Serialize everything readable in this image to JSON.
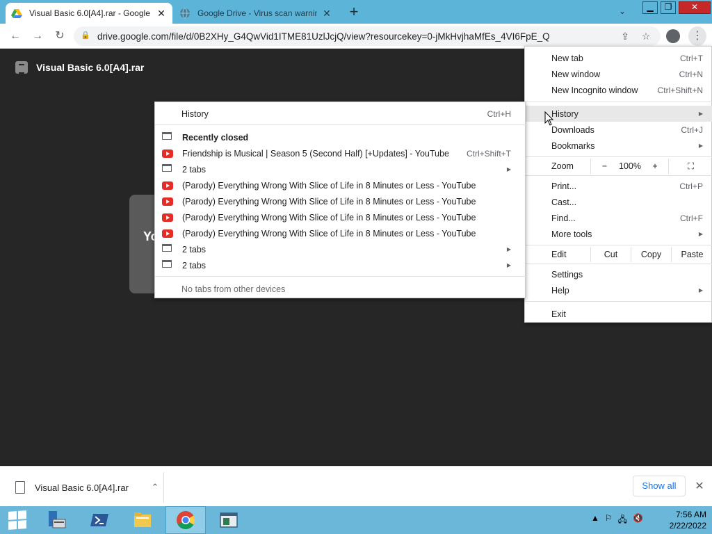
{
  "browser": {
    "tabs": [
      {
        "title": "Visual Basic 6.0[A4].rar - Google",
        "icon": "google-drive-icon",
        "active": true
      },
      {
        "title": "Google Drive - Virus scan warnin",
        "icon": "globe-icon",
        "active": false
      }
    ],
    "url": "drive.google.com/file/d/0B2XHy_G4QwVid1ITME81UzlJcjQ/view?resourcekey=0-jMkHvjhaMfEs_4VI6FpE_Q"
  },
  "page": {
    "file_title": "Visual Basic 6.0[A4].rar",
    "dialog_text_partial": "Yo"
  },
  "menu": {
    "new_tab": {
      "label": "New tab",
      "shortcut": "Ctrl+T"
    },
    "new_window": {
      "label": "New window",
      "shortcut": "Ctrl+N"
    },
    "incognito": {
      "label": "New Incognito window",
      "shortcut": "Ctrl+Shift+N"
    },
    "history": {
      "label": "History"
    },
    "downloads": {
      "label": "Downloads",
      "shortcut": "Ctrl+J"
    },
    "bookmarks": {
      "label": "Bookmarks"
    },
    "zoom": {
      "label": "Zoom",
      "minus": "−",
      "value": "100%",
      "plus": "+"
    },
    "print": {
      "label": "Print...",
      "shortcut": "Ctrl+P"
    },
    "cast": {
      "label": "Cast..."
    },
    "find": {
      "label": "Find...",
      "shortcut": "Ctrl+F"
    },
    "more_tools": {
      "label": "More tools"
    },
    "edit": {
      "label": "Edit",
      "cut": "Cut",
      "copy": "Copy",
      "paste": "Paste"
    },
    "settings": {
      "label": "Settings"
    },
    "help": {
      "label": "Help"
    },
    "exit": {
      "label": "Exit"
    }
  },
  "history_menu": {
    "history": {
      "label": "History",
      "shortcut": "Ctrl+H"
    },
    "recently_closed": "Recently closed",
    "items": [
      {
        "label": "Friendship is Musical | Season 5 (Second Half) [+Updates] - YouTube",
        "shortcut": "Ctrl+Shift+T",
        "type": "youtube"
      },
      {
        "label": "2 tabs",
        "type": "tabs"
      },
      {
        "label": "(Parody) Everything Wrong With Slice of Life in 8 Minutes or Less - YouTube",
        "type": "youtube"
      },
      {
        "label": "(Parody) Everything Wrong With Slice of Life in 8 Minutes or Less - YouTube",
        "type": "youtube"
      },
      {
        "label": "(Parody) Everything Wrong With Slice of Life in 8 Minutes or Less - YouTube",
        "type": "youtube"
      },
      {
        "label": "(Parody) Everything Wrong With Slice of Life in 8 Minutes or Less - YouTube",
        "type": "youtube"
      },
      {
        "label": "2 tabs",
        "type": "tabs"
      },
      {
        "label": "2 tabs",
        "type": "tabs"
      }
    ],
    "no_other_devices": "No tabs from other devices"
  },
  "download_shelf": {
    "file_name": "Visual Basic 6.0[A4].rar",
    "show_all": "Show all"
  },
  "taskbar": {
    "time": "7:56 AM",
    "date": "2/22/2022"
  },
  "colors": {
    "tabstrip": "#5cb4d9",
    "taskbar": "#6ab7d9",
    "content_bg": "#262626",
    "youtube_red": "#e52d27",
    "link_blue": "#1a73e8"
  }
}
